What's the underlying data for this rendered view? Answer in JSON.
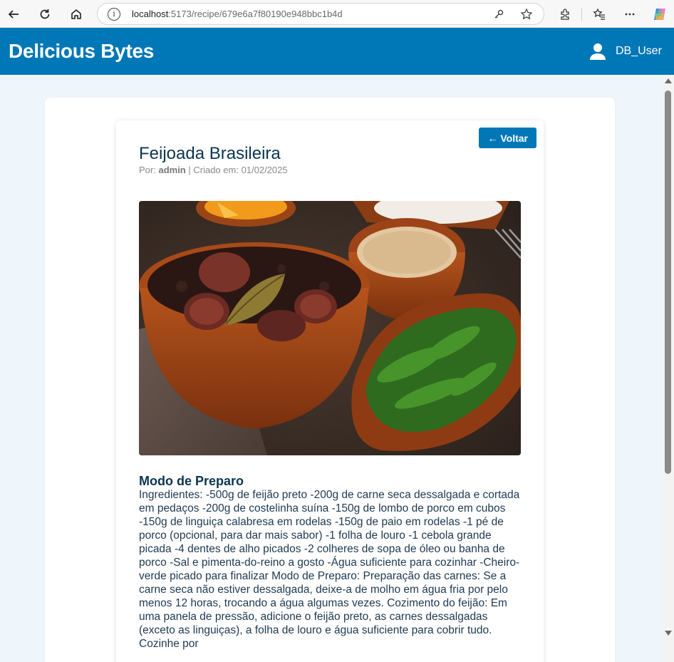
{
  "browser": {
    "url_host": "localhost",
    "url_path": ":5173/recipe/679e6a7f80190e948bbc1b4d",
    "icons": [
      "back-arrow-icon",
      "refresh-icon",
      "home-icon",
      "info-icon",
      "key-icon",
      "star-icon",
      "extensions-icon",
      "favorites-icon",
      "more-icon",
      "copilot-icon"
    ]
  },
  "header": {
    "brand": "Delicious Bytes",
    "user_name": "DB_User"
  },
  "recipe": {
    "back_label": "← Voltar",
    "title": "Feijoada Brasileira",
    "meta_prefix": "Por: ",
    "author": "admin",
    "meta_separator": " | Criado em: ",
    "created": "01/02/2025",
    "image_alt": "feijoada",
    "section_title": "Modo de Preparo",
    "body": "Ingredientes: -500g de feijão preto -200g de carne seca dessalgada e cortada em pedaços -200g de costelinha suína -150g de lombo de porco em cubos -150g de linguiça calabresa em rodelas -150g de paio em rodelas -1 pé de porco (opcional, para dar mais sabor) -1 folha de louro -1 cebola grande picada -4 dentes de alho picados -2 colheres de sopa de óleo ou banha de porco -Sal e pimenta-do-reino a gosto -Água suficiente para cozinhar -Cheiro-verde picado para finalizar Modo de Preparo: Preparação das carnes: Se a carne seca não estiver dessalgada, deixe-a de molho em água fria por pelo menos 12 horas, trocando a água algumas vezes. Cozimento do feijão: Em uma panela de pressão, adicione o feijão preto, as carnes dessalgadas (exceto as linguiças), a folha de louro e água suficiente para cobrir tudo. Cozinhe por"
  },
  "colors": {
    "primary": "#0077b6",
    "page_bg": "#eef5fb",
    "title": "#0b3550"
  }
}
